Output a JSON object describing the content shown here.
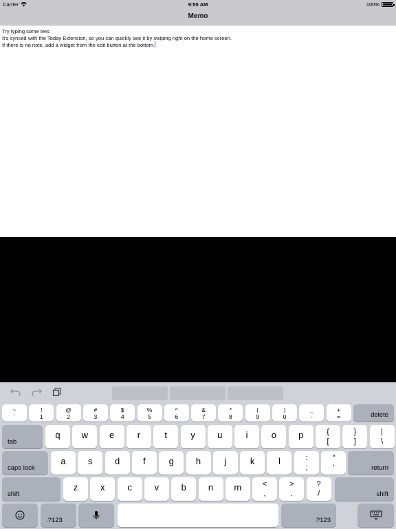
{
  "status_bar": {
    "carrier": "Carrier",
    "time": "9:55 AM",
    "battery": "100%",
    "battery_level": 1.0
  },
  "nav": {
    "title": "Memo"
  },
  "memo": {
    "lines": [
      "Try typing some text.",
      "It's synced with the Today Extension, so you can quickly see it by swiping right on the home screen.",
      "If there is no note, add a widget from the edit button at the bottom."
    ]
  },
  "keyboard": {
    "shortcuts": {
      "undo_icon": "undo-icon",
      "redo_icon": "redo-icon",
      "paste_icon": "paste-icon"
    },
    "row1": [
      {
        "up": "~",
        "low": "`"
      },
      {
        "up": "!",
        "low": "1"
      },
      {
        "up": "@",
        "low": "2"
      },
      {
        "up": "#",
        "low": "3"
      },
      {
        "up": "$",
        "low": "4"
      },
      {
        "up": "%",
        "low": "5"
      },
      {
        "up": "^",
        "low": "6"
      },
      {
        "up": "&",
        "low": "7"
      },
      {
        "up": "*",
        "low": "8"
      },
      {
        "up": "(",
        "low": "9"
      },
      {
        "up": ")",
        "low": "0"
      },
      {
        "up": "_",
        "low": "-"
      },
      {
        "up": "+",
        "low": "="
      }
    ],
    "delete": "delete",
    "tab": "tab",
    "row2": [
      "q",
      "w",
      "e",
      "r",
      "t",
      "y",
      "u",
      "i",
      "o",
      "p"
    ],
    "row2_syms": [
      {
        "up": "{",
        "low": "["
      },
      {
        "up": "}",
        "low": "]"
      },
      {
        "up": "|",
        "low": "\\"
      }
    ],
    "caps_lock": "caps lock",
    "row3": [
      "a",
      "s",
      "d",
      "f",
      "g",
      "h",
      "j",
      "k",
      "l"
    ],
    "row3_syms": [
      {
        "up": ":",
        "low": ";"
      },
      {
        "up": "\"",
        "low": "'"
      }
    ],
    "return": "return",
    "shift_left": "shift",
    "row4": [
      "z",
      "x",
      "c",
      "v",
      "b",
      "n",
      "m"
    ],
    "row4_syms": [
      {
        "up": "<",
        "low": ","
      },
      {
        "up": ">",
        "low": "."
      },
      {
        "up": "?",
        "low": "/"
      }
    ],
    "shift_right": "shift",
    "bottom": {
      "emoji_icon": "emoji-icon",
      "numbers_left": ".?123",
      "mic_icon": "microphone-icon",
      "space": "",
      "numbers_right": ".?123",
      "dismiss_icon": "keyboard-dismiss-icon"
    }
  }
}
